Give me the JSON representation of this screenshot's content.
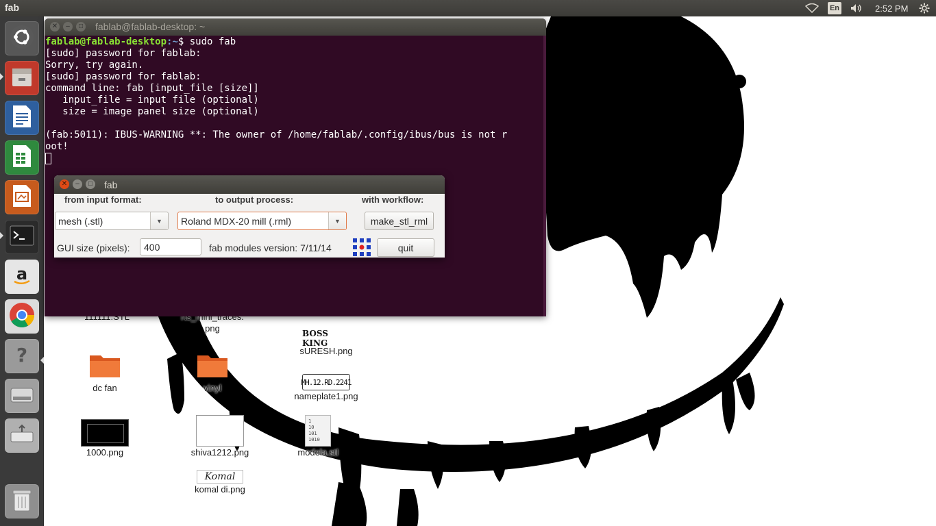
{
  "top_panel": {
    "app_title": "fab",
    "language": "En",
    "clock": "2:52 PM"
  },
  "launcher": {
    "items": [
      {
        "name": "dash-home",
        "icon": "ubuntu-logo-icon"
      },
      {
        "name": "files",
        "icon": "file-manager-icon"
      },
      {
        "name": "writer",
        "icon": "libreoffice-writer-icon"
      },
      {
        "name": "calc",
        "icon": "libreoffice-calc-icon"
      },
      {
        "name": "impress",
        "icon": "libreoffice-impress-icon"
      },
      {
        "name": "terminal",
        "icon": "terminal-icon"
      },
      {
        "name": "amazon",
        "icon": "amazon-icon"
      },
      {
        "name": "chrome",
        "icon": "chrome-icon"
      },
      {
        "name": "help",
        "icon": "help-icon"
      },
      {
        "name": "disk",
        "icon": "hard-disk-icon"
      },
      {
        "name": "usb",
        "icon": "usb-drive-icon"
      },
      {
        "name": "trash",
        "icon": "trash-icon"
      }
    ]
  },
  "terminal": {
    "title": "fablab@fablab-desktop: ~",
    "prompt_user": "fablab@fablab-desktop",
    "prompt_path": ":~",
    "prompt_cmd": "$ sudo fab",
    "lines": [
      "[sudo] password for fablab:",
      "Sorry, try again.",
      "[sudo] password for fablab:",
      "command line: fab [input_file [size]]",
      "   input_file = input file (optional)",
      "   size = image panel size (optional)",
      "",
      "(fab:5011): IBUS-WARNING **: The owner of /home/fablab/.config/ibus/bus is not r",
      "oot!"
    ]
  },
  "fab_dialog": {
    "title": "fab",
    "header_input": "from input format:",
    "header_output": "to output process:",
    "header_workflow": "with workflow:",
    "input_format": "mesh (.stl)",
    "output_process": "Roland MDX-20 mill (.rml)",
    "workflow_button": "make_stl_rml",
    "gui_size_label": "GUI size (pixels):",
    "gui_size_value": "400",
    "version": "fab modules version: 7/11/14",
    "quit_button": "quit"
  },
  "desktop_icons": [
    {
      "label": "111111.STL"
    },
    {
      "label": "rts_mini_traces.\npng"
    },
    {
      "label": "sURESH.png",
      "thumb_text": "BOSS KING"
    },
    {
      "label": "dc fan"
    },
    {
      "label": "vinyl"
    },
    {
      "label": "nameplate1.png",
      "thumb_text": "MH.12.RD.2241"
    },
    {
      "label": "1000.png"
    },
    {
      "label": "shiva1212.png"
    },
    {
      "label": "modela.stl",
      "thumb_text": "1\n10\n101\n1010"
    },
    {
      "label": "komal di.png",
      "thumb_text": "Komal"
    }
  ]
}
